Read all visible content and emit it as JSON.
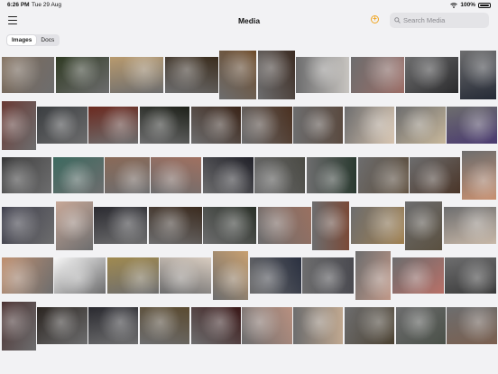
{
  "status_bar": {
    "time": "6:26 PM",
    "date": "Tue 29 Aug",
    "battery": "100%"
  },
  "nav": {
    "title": "Media",
    "search_placeholder": "Search Media"
  },
  "tabs": [
    {
      "label": "Images",
      "active": true
    },
    {
      "label": "Docs",
      "active": false
    }
  ],
  "colors": {
    "accent": "#f0a623",
    "background": "#f2f2f4"
  },
  "icons": [
    "menu-icon",
    "add-icon",
    "search-icon",
    "wifi-icon",
    "battery-icon"
  ],
  "gallery": {
    "rows": [
      [
        {
          "w": 52,
          "c": "#7d6a58"
        },
        {
          "w": 52,
          "c": "#2f3a23"
        },
        {
          "w": 52,
          "c": "#b89a6e"
        },
        {
          "w": 52,
          "c": "#3a2c1d"
        },
        {
          "w": 36,
          "c": "#6d4a28"
        },
        {
          "w": 36,
          "c": "#3b2b22"
        },
        {
          "w": 52,
          "c": "#c7c4c0"
        },
        {
          "w": 52,
          "c": "#9c6d66"
        },
        {
          "w": 52,
          "c": "#2a2a2c"
        },
        {
          "w": 36,
          "c": "#252a36"
        }
      ],
      [
        {
          "w": 36,
          "c": "#6a3a35"
        },
        {
          "w": 52,
          "c": "#3a3d40"
        },
        {
          "w": 52,
          "c": "#6b2a20"
        },
        {
          "w": 52,
          "c": "#1d2019"
        },
        {
          "w": 52,
          "c": "#3a2418"
        },
        {
          "w": 52,
          "c": "#4a3020"
        },
        {
          "w": 52,
          "c": "#5a4a40"
        },
        {
          "w": 52,
          "c": "#d8c5b0"
        },
        {
          "w": 52,
          "c": "#c8b89c"
        },
        {
          "w": 52,
          "c": "#4a3a70"
        }
      ],
      [
        {
          "w": 52,
          "c": "#3a3a3a"
        },
        {
          "w": 52,
          "c": "#3d6a60"
        },
        {
          "w": 46,
          "c": "#8a6a58"
        },
        {
          "w": 52,
          "c": "#a07060"
        },
        {
          "w": 52,
          "c": "#202028"
        },
        {
          "w": 52,
          "c": "#4a4a44"
        },
        {
          "w": 52,
          "c": "#2a3a30"
        },
        {
          "w": 52,
          "c": "#5a4a38"
        },
        {
          "w": 52,
          "c": "#4a3528"
        },
        {
          "w": 36,
          "c": "#c89070"
        }
      ],
      [
        {
          "w": 52,
          "c": "#3a3a48"
        },
        {
          "w": 36,
          "c": "#c8a898"
        },
        {
          "w": 52,
          "c": "#2a2a30"
        },
        {
          "w": 52,
          "c": "#3a2a1e"
        },
        {
          "w": 52,
          "c": "#2a3028"
        },
        {
          "w": 52,
          "c": "#9a7060"
        },
        {
          "w": 36,
          "c": "#7a4a38"
        },
        {
          "w": 52,
          "c": "#a08050"
        },
        {
          "w": 36,
          "c": "#5a5040"
        },
        {
          "w": 52,
          "c": "#c8b8a8"
        }
      ],
      [
        {
          "w": 52,
          "c": "#c09070"
        },
        {
          "w": 52,
          "c": "#f8f8f8"
        },
        {
          "w": 52,
          "c": "#a08a50"
        },
        {
          "w": 52,
          "c": "#d8ccc0"
        },
        {
          "w": 36,
          "c": "#c8a070"
        },
        {
          "w": 52,
          "c": "#2a3040"
        },
        {
          "w": 52,
          "c": "#4a4a50"
        },
        {
          "w": 36,
          "c": "#c09888"
        },
        {
          "w": 52,
          "c": "#b87068"
        },
        {
          "w": 52,
          "c": "#3a3a3a"
        }
      ],
      [
        {
          "w": 36,
          "c": "#4a3030"
        },
        {
          "w": 52,
          "c": "#2a2420"
        },
        {
          "w": 52,
          "c": "#2a2a30"
        },
        {
          "w": 52,
          "c": "#5a4a30"
        },
        {
          "w": 52,
          "c": "#3a1818"
        },
        {
          "w": 52,
          "c": "#b89080"
        },
        {
          "w": 52,
          "c": "#c0a890"
        },
        {
          "w": 52,
          "c": "#4a4030"
        },
        {
          "w": 52,
          "c": "#4a5048"
        },
        {
          "w": 52,
          "c": "#7a6050"
        }
      ]
    ]
  }
}
